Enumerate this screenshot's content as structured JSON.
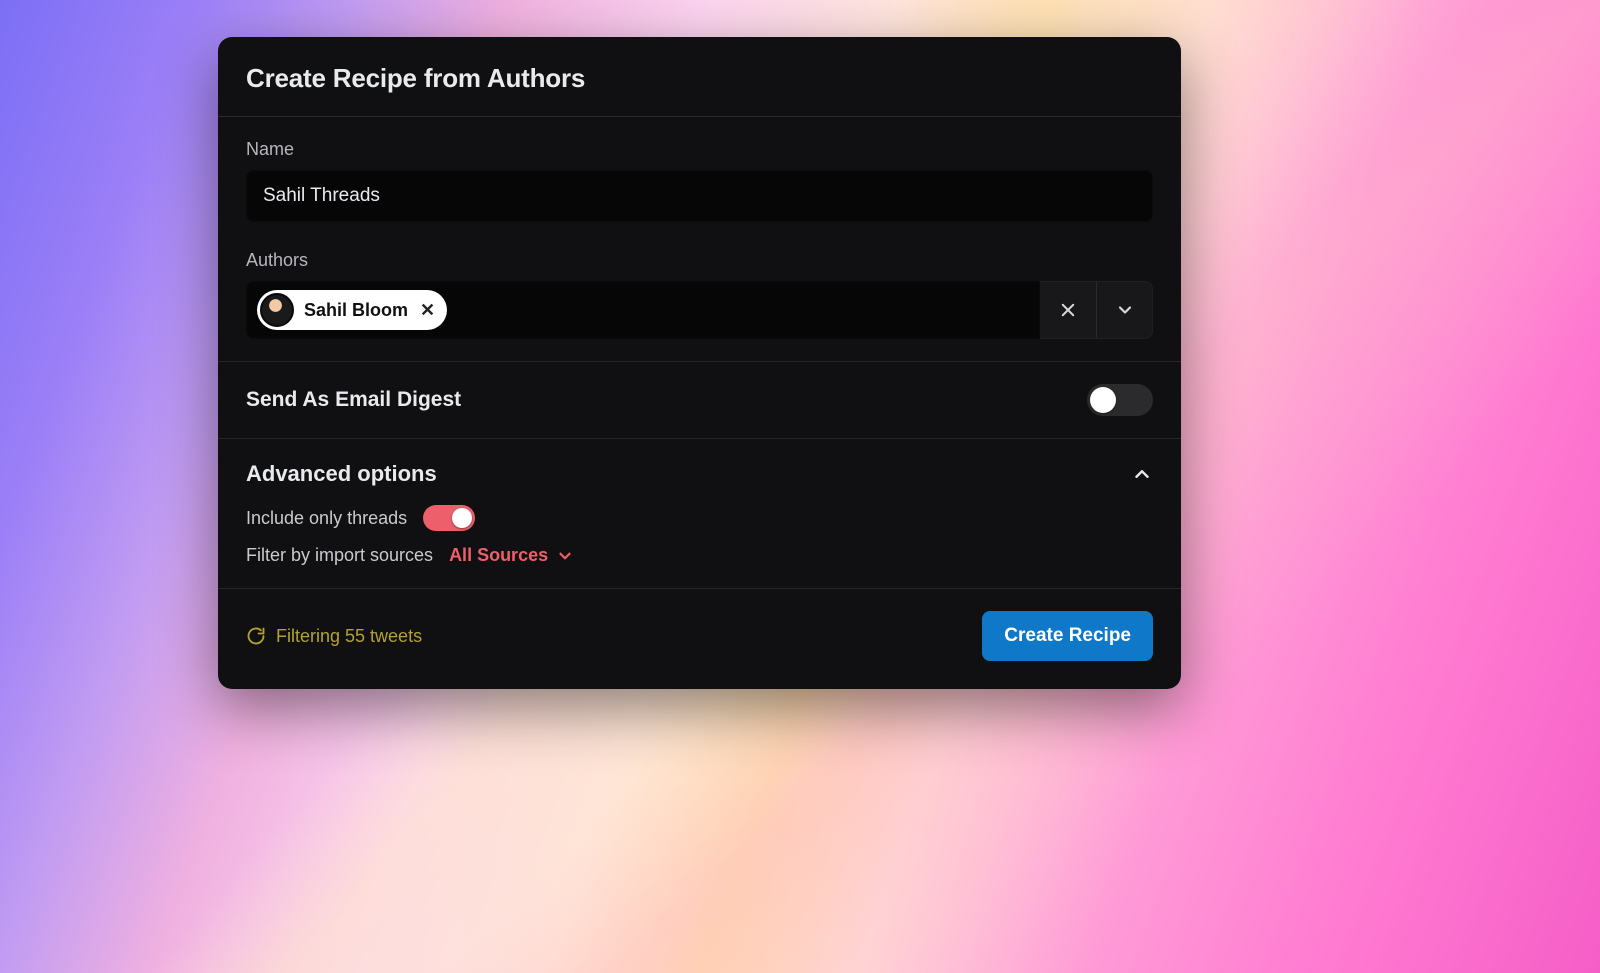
{
  "modal": {
    "title": "Create Recipe from Authors",
    "name_label": "Name",
    "name_value": "Sahil Threads",
    "authors_label": "Authors",
    "author_chips": [
      {
        "name": "Sahil Bloom"
      }
    ],
    "email_digest_label": "Send As Email Digest",
    "email_digest_on": false,
    "advanced": {
      "header": "Advanced options",
      "expanded": true,
      "include_threads_label": "Include only threads",
      "include_threads_on": true,
      "filter_sources_label": "Filter by import sources",
      "filter_sources_value": "All Sources"
    },
    "status_text": "Filtering 55 tweets",
    "submit_label": "Create Recipe"
  }
}
